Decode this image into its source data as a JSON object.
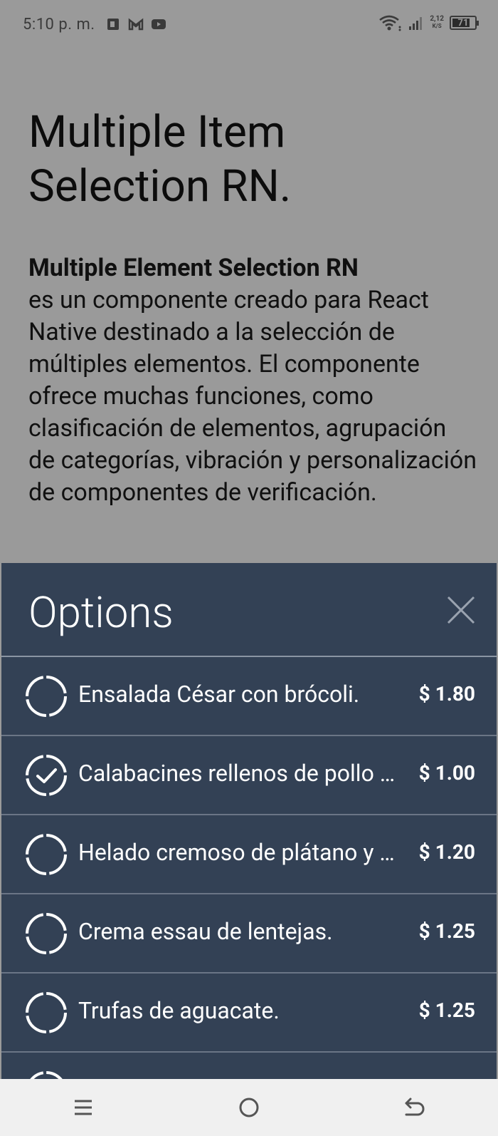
{
  "status_bar": {
    "time": "5:10 p. m.",
    "net_speed_value": "2,12",
    "net_speed_unit": "K/S",
    "battery_level": "71",
    "left_icons": [
      "office-app-icon",
      "gmail-icon",
      "youtube-icon"
    ],
    "right_icons": [
      "wifi-icon",
      "signal-icon"
    ]
  },
  "page": {
    "title": "Multiple Item Selection RN.",
    "description_bold": "Multiple Element Selection RN",
    "description_text": "es un componente creado para React Native destinado a la selección de múltiples elementos. El componente ofrece muchas funciones, como clasificación de elementos, agrupación de categorías, vibración y personalización de componentes de verificación."
  },
  "sheet": {
    "title": "Options",
    "items": [
      {
        "label": "Ensalada César con brócoli.",
        "price": "$ 1.80",
        "selected": false
      },
      {
        "label": "Calabacines rellenos de pollo y verduras.",
        "price": "$ 1.00",
        "selected": true
      },
      {
        "label": "Helado cremoso de plátano y canela.",
        "price": "$ 1.20",
        "selected": false
      },
      {
        "label": "Crema essau de lentejas.",
        "price": "$ 1.25",
        "selected": false
      },
      {
        "label": "Trufas de aguacate.",
        "price": "$ 1.25",
        "selected": false
      }
    ]
  },
  "nav_bar": {
    "buttons": [
      "menu-icon",
      "home-icon",
      "back-icon"
    ]
  },
  "colors": {
    "overlay": "#9a9a9a",
    "sheet_bg": "#334155",
    "divider": "#6b7586",
    "nav_bg": "#f0f0f0"
  }
}
